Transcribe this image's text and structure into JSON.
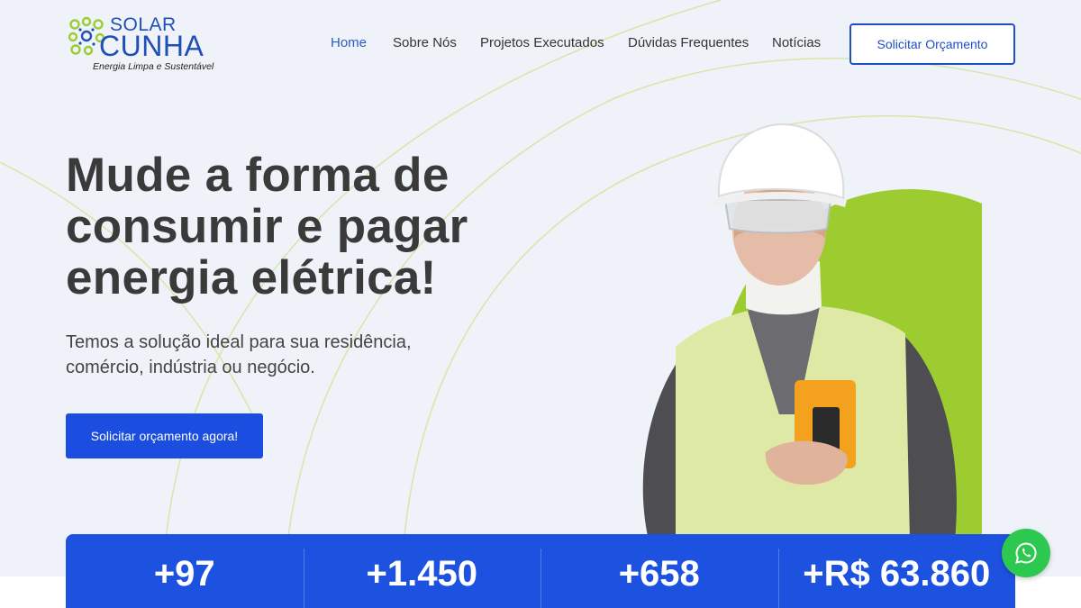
{
  "brand": {
    "line1": "SOLAR",
    "line2": "CUNHA",
    "tagline": "Energia Limpa e Sustentável",
    "primary_color": "#1e50b8",
    "accent_color": "#9acd32"
  },
  "nav": {
    "items": [
      {
        "label": "Home",
        "active": true
      },
      {
        "label": "Sobre Nós",
        "active": false
      },
      {
        "label": "Projetos Executados",
        "active": false
      },
      {
        "label": "Dúvidas Frequentes",
        "active": false
      },
      {
        "label": "Notícias",
        "active": false
      }
    ],
    "cta_label": "Solicitar Orçamento"
  },
  "hero": {
    "title_lines": [
      "Mude a forma de",
      "consumir e pagar",
      "energia elétrica!"
    ],
    "subtitle_lines": [
      "Temos a solução ideal para sua residência,",
      "comércio, indústria ou negócio."
    ],
    "button_label": "Solicitar orçamento agora!",
    "image_icon": "worker-photo"
  },
  "stats": [
    {
      "value": "+97"
    },
    {
      "value": "+1.450"
    },
    {
      "value": "+658"
    },
    {
      "value": "+R$ 63.860"
    }
  ],
  "whatsapp": {
    "icon": "whatsapp-icon",
    "color": "#2cc84f"
  }
}
